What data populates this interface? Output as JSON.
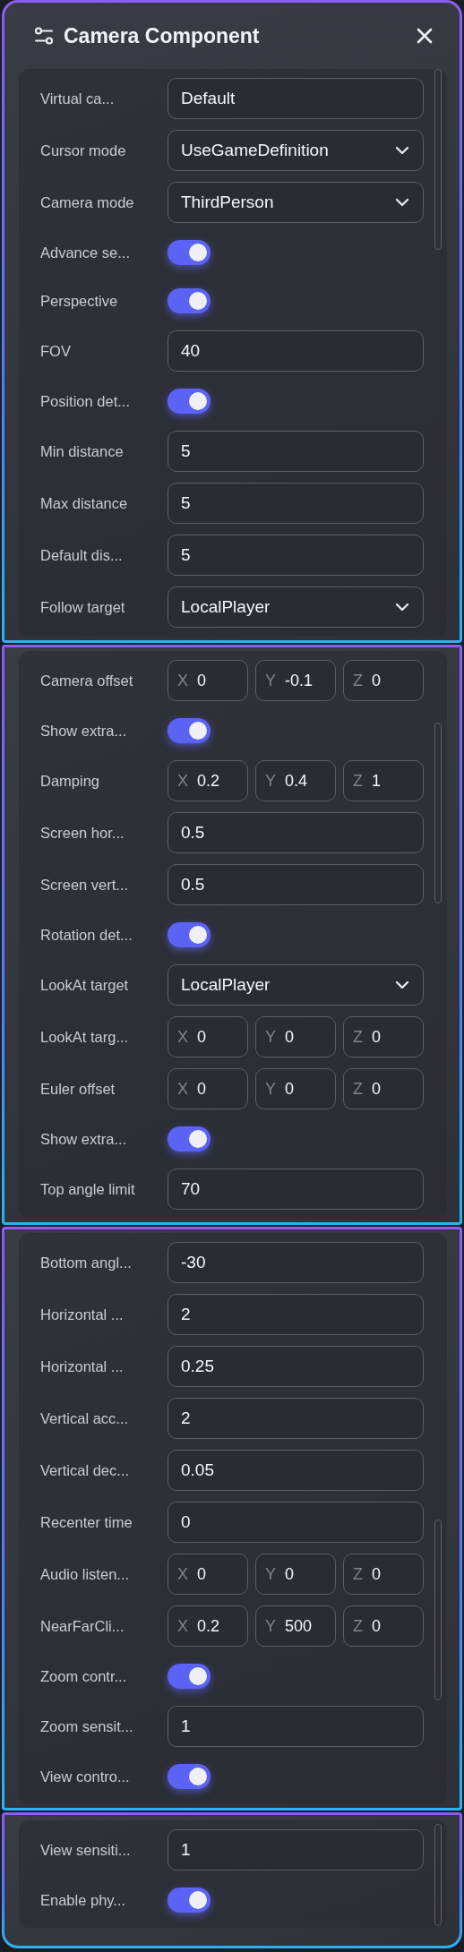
{
  "title": "Camera Component",
  "segments": [
    {
      "rows": [
        {
          "kind": "text",
          "label": "Virtual ca...",
          "value": "Default"
        },
        {
          "kind": "select",
          "label": "Cursor mode",
          "value": "UseGameDefinition"
        },
        {
          "kind": "select",
          "label": "Camera mode",
          "value": "ThirdPerson"
        },
        {
          "kind": "toggle",
          "label": "Advance se...",
          "on": true
        },
        {
          "kind": "toggle",
          "label": "Perspective",
          "on": true
        },
        {
          "kind": "text",
          "label": "FOV",
          "value": "40"
        },
        {
          "kind": "toggle",
          "label": "Position det...",
          "on": true
        },
        {
          "kind": "text",
          "label": "Min distance",
          "value": "5"
        },
        {
          "kind": "text",
          "label": "Max distance",
          "value": "5"
        },
        {
          "kind": "text",
          "label": "Default dis...",
          "value": "5"
        },
        {
          "kind": "select",
          "label": "Follow target",
          "value": "LocalPlayer"
        }
      ]
    },
    {
      "rows": [
        {
          "kind": "vector",
          "label": "Camera offset",
          "axes": [
            {
              "axis": "X",
              "value": "0"
            },
            {
              "axis": "Y",
              "value": "-0.1"
            },
            {
              "axis": "Z",
              "value": "0"
            }
          ]
        },
        {
          "kind": "toggle",
          "label": "Show extra...",
          "on": true
        },
        {
          "kind": "vector",
          "label": "Damping",
          "axes": [
            {
              "axis": "X",
              "value": "0.2"
            },
            {
              "axis": "Y",
              "value": "0.4"
            },
            {
              "axis": "Z",
              "value": "1"
            }
          ]
        },
        {
          "kind": "text",
          "label": "Screen hor...",
          "value": "0.5"
        },
        {
          "kind": "text",
          "label": "Screen vert...",
          "value": "0.5"
        },
        {
          "kind": "toggle",
          "label": "Rotation det...",
          "on": true
        },
        {
          "kind": "select",
          "label": "LookAt target",
          "value": "LocalPlayer"
        },
        {
          "kind": "vector",
          "label": "LookAt targ...",
          "axes": [
            {
              "axis": "X",
              "value": "0"
            },
            {
              "axis": "Y",
              "value": "0"
            },
            {
              "axis": "Z",
              "value": "0"
            }
          ]
        },
        {
          "kind": "vector",
          "label": "Euler offset",
          "axes": [
            {
              "axis": "X",
              "value": "0"
            },
            {
              "axis": "Y",
              "value": "0"
            },
            {
              "axis": "Z",
              "value": "0"
            }
          ]
        },
        {
          "kind": "toggle",
          "label": "Show extra...",
          "on": true
        },
        {
          "kind": "text",
          "label": "Top angle limit",
          "value": "70"
        }
      ]
    },
    {
      "rows": [
        {
          "kind": "text",
          "label": "Bottom angl...",
          "value": "-30"
        },
        {
          "kind": "text",
          "label": "Horizontal ...",
          "value": "2"
        },
        {
          "kind": "text",
          "label": "Horizontal ...",
          "value": "0.25"
        },
        {
          "kind": "text",
          "label": "Vertical acc...",
          "value": "2"
        },
        {
          "kind": "text",
          "label": "Vertical dec...",
          "value": "0.05"
        },
        {
          "kind": "text",
          "label": "Recenter time",
          "value": "0"
        },
        {
          "kind": "vector",
          "label": "Audio listen...",
          "axes": [
            {
              "axis": "X",
              "value": "0"
            },
            {
              "axis": "Y",
              "value": "0"
            },
            {
              "axis": "Z",
              "value": "0"
            }
          ]
        },
        {
          "kind": "vector",
          "label": "NearFarCli...",
          "axes": [
            {
              "axis": "X",
              "value": "0.2"
            },
            {
              "axis": "Y",
              "value": "500"
            },
            {
              "axis": "Z",
              "value": "0"
            }
          ]
        },
        {
          "kind": "toggle",
          "label": "Zoom contr...",
          "on": true
        },
        {
          "kind": "text",
          "label": "Zoom sensit...",
          "value": "1"
        },
        {
          "kind": "toggle",
          "label": "View contro...",
          "on": true
        }
      ]
    },
    {
      "rows": [
        {
          "kind": "text",
          "label": "View sensiti...",
          "value": "1"
        },
        {
          "kind": "toggle",
          "label": "Enable phy...",
          "on": true
        }
      ]
    }
  ]
}
